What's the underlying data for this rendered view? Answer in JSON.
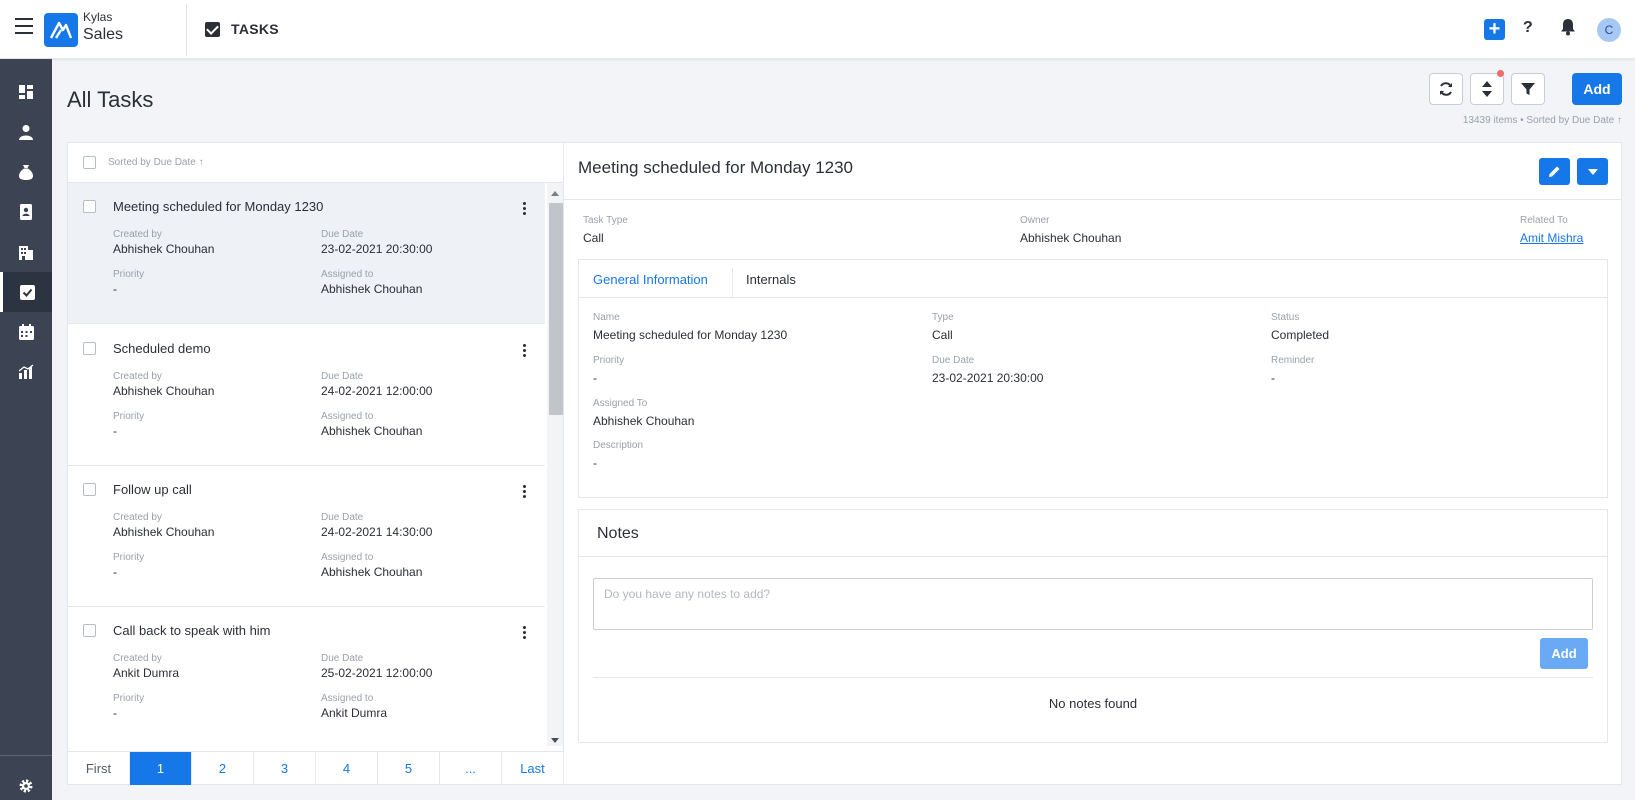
{
  "header": {
    "brand_small": "Kylas",
    "brand_big": "Sales",
    "module_label": "TASKS",
    "plus_label": "+",
    "help_label": "?",
    "avatar_initial": "C",
    "accent": "#1677e8"
  },
  "rail": {
    "items": [
      {
        "icon": "dashboard-icon"
      },
      {
        "icon": "user-icon"
      },
      {
        "icon": "money-bag-icon"
      },
      {
        "icon": "contact-card-icon"
      },
      {
        "icon": "building-icon"
      },
      {
        "icon": "tasks-icon",
        "active": true
      },
      {
        "icon": "calendar-icon"
      },
      {
        "icon": "reports-icon"
      }
    ],
    "bottom_icon": "gear-icon"
  },
  "page": {
    "title": "All Tasks",
    "add_label": "Add",
    "meta": "13439 items • Sorted by Due Date ↑"
  },
  "list": {
    "sort_text": "Sorted by Due Date ↑",
    "tasks": [
      {
        "title": "Meeting scheduled for Monday 1230",
        "created_by_label": "Created by",
        "created_by": "Abhishek Chouhan",
        "due_label": "Due Date",
        "due": "23-02-2021 20:30:00",
        "priority_label": "Priority",
        "priority": "-",
        "assigned_label": "Assigned to",
        "assigned": "Abhishek Chouhan"
      },
      {
        "title": "Scheduled demo",
        "created_by_label": "Created by",
        "created_by": "Abhishek Chouhan",
        "due_label": "Due Date",
        "due": "24-02-2021 12:00:00",
        "priority_label": "Priority",
        "priority": "-",
        "assigned_label": "Assigned to",
        "assigned": "Abhishek Chouhan"
      },
      {
        "title": "Follow up call",
        "created_by_label": "Created by",
        "created_by": "Abhishek Chouhan",
        "due_label": "Due Date",
        "due": "24-02-2021 14:30:00",
        "priority_label": "Priority",
        "priority": "-",
        "assigned_label": "Assigned to",
        "assigned": "Abhishek Chouhan"
      },
      {
        "title": "Call back to speak with him",
        "created_by_label": "Created by",
        "created_by": "Ankit Dumra",
        "due_label": "Due Date",
        "due": "25-02-2021 12:00:00",
        "priority_label": "Priority",
        "priority": "-",
        "assigned_label": "Assigned to",
        "assigned": "Ankit Dumra"
      }
    ],
    "pager": [
      "First",
      "1",
      "2",
      "3",
      "4",
      "5",
      "...",
      "Last"
    ],
    "active_page": "1"
  },
  "detail": {
    "title": "Meeting scheduled for Monday 1230",
    "task_type_label": "Task Type",
    "task_type": "Call",
    "owner_label": "Owner",
    "owner": "Abhishek Chouhan",
    "related_label": "Related To",
    "related": "Amit Mishra",
    "tabs": [
      "General Information",
      "Internals"
    ],
    "fields": {
      "name_label": "Name",
      "name": "Meeting scheduled for Monday 1230",
      "type_label": "Type",
      "type": "Call",
      "status_label": "Status",
      "status": "Completed",
      "priority_label": "Priority",
      "priority": "-",
      "due_label": "Due Date",
      "due": "23-02-2021 20:30:00",
      "reminder_label": "Reminder",
      "reminder": "-",
      "assigned_label": "Assigned To",
      "assigned": "Abhishek Chouhan",
      "description_label": "Description",
      "description": "-"
    }
  },
  "notes": {
    "title": "Notes",
    "placeholder": "Do you have any notes to add?",
    "add_label": "Add",
    "empty": "No notes found"
  }
}
